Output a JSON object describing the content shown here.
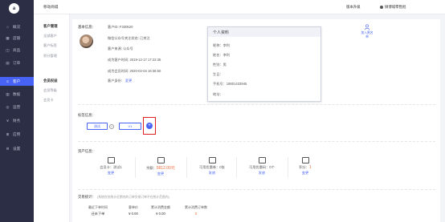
{
  "app": {
    "title": "移动商城",
    "logo_letter": "a"
  },
  "topbar": {
    "upgrade": "版本升级",
    "user": "微博城零售批"
  },
  "nav": [
    {
      "icon": "home-icon",
      "label": "概况"
    },
    {
      "icon": "shop-icon",
      "label": "店铺"
    },
    {
      "icon": "goods-icon",
      "label": "商品"
    },
    {
      "icon": "order-icon",
      "label": "订单"
    },
    {
      "icon": "customer-icon",
      "label": "客户"
    },
    {
      "icon": "data-icon",
      "label": "数据"
    },
    {
      "icon": "asset-icon",
      "label": "运营"
    },
    {
      "icon": "finance-icon",
      "label": "财务"
    },
    {
      "icon": "app-icon",
      "label": "应用"
    },
    {
      "icon": "settings-icon",
      "label": "设置"
    }
  ],
  "subnav": {
    "group1_title": "客户管理",
    "group1_items": [
      "全部客户",
      "客户标签",
      "积分管理"
    ],
    "group2_title": "会员权益",
    "group2_items": [
      "会员等级",
      "会员卡"
    ]
  },
  "basic": {
    "label": "基本信息：",
    "customer_id": "客户ID: F330520",
    "wechat": "微信公众号关注状态: 已关注",
    "source": "客户来源: 公众号",
    "became_customer": "成为客户时间: 2019-12-17 17:22:35",
    "became_member": "成为会员时间: 2020-02-04 16:36:50",
    "identity": "客户身份:",
    "identity_link": "変更"
  },
  "popover": {
    "title": "个人资料",
    "nickname": "呢称：李利",
    "name": "姓名：李利",
    "gender": "性别：男",
    "birthday": "生日：",
    "phone": "手机号：18801433945",
    "address": "地址："
  },
  "add_friend": {
    "label": "加入黑名单"
  },
  "tags": {
    "label": "标签信息：",
    "items": [
      "测试",
      "V1"
    ],
    "add": "+"
  },
  "assets": {
    "label": "资产信息：",
    "items": [
      {
        "title": "会员卡：测试1",
        "value": "",
        "link": "变更"
      },
      {
        "title": "余额：",
        "value": "5812.00元",
        "link": "变更"
      },
      {
        "title": "可用优惠券：0张",
        "value": "",
        "link": "发放"
      },
      {
        "title": "可用优惠码：0个",
        "value": "",
        "link": "发放"
      },
      {
        "title": "积分：",
        "value": "1",
        "link": "变更"
      }
    ]
  },
  "stats": {
    "label": "交易统计：",
    "note": "(系统仅仅统计近期内的订单交易订单不在统计范围内)",
    "columns": [
      {
        "header": "最近下单时间",
        "value": "还未下单"
      },
      {
        "header": "客单价",
        "value": "¥ 0.00"
      },
      {
        "header": "累计消费金额",
        "value": "¥ 0.00"
      },
      {
        "header": "累计消费订单数",
        "value": "0"
      }
    ]
  },
  "colors": {
    "accent": "#4763f5",
    "nav_bg": "#2b2e45",
    "highlight": "#e02020",
    "value": "#f36b3b"
  }
}
